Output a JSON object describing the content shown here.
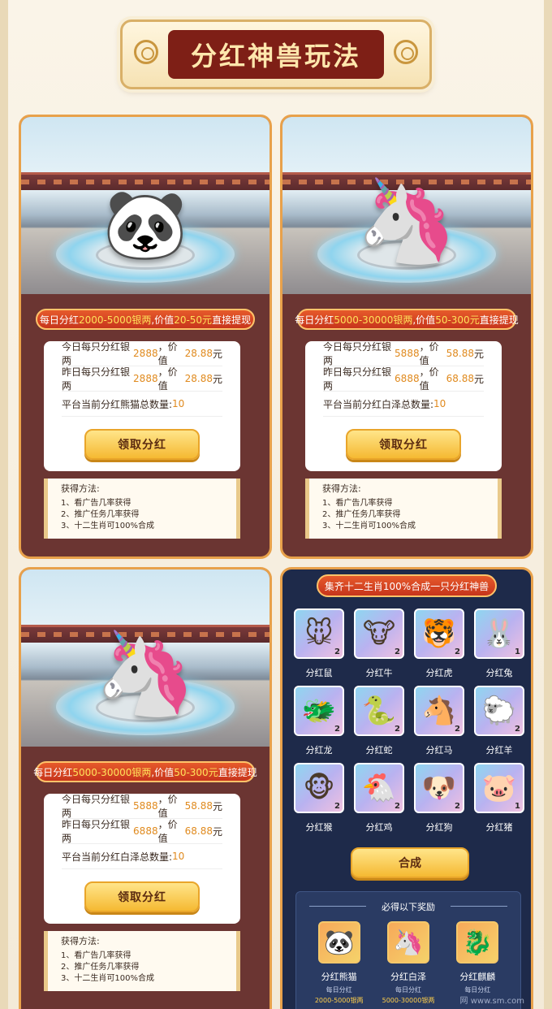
{
  "header": {
    "title": "分红神兽玩法"
  },
  "cards": [
    {
      "creature_icon": "panda",
      "tag": {
        "prefix": "每日分红",
        "silver": "2000-5000银两",
        "mid": ",价值",
        "value": "20-50元",
        "suffix": "直接提现"
      },
      "rows": [
        {
          "label": "今日每只分红银两",
          "silver": "2888",
          "mid": "，价值",
          "value": "28.88",
          "unit": "元"
        },
        {
          "label": "昨日每只分红银两",
          "silver": "2888",
          "mid": "，价值",
          "value": "28.88",
          "unit": "元"
        }
      ],
      "total_label": "平台当前分红熊猫总数量:",
      "total_value": "10",
      "button": "领取分红",
      "method_title": "获得方法:",
      "methods": [
        "1、看广告几率获得",
        "2、推广任务几率获得",
        "3、十二生肖可100%合成"
      ]
    },
    {
      "creature_icon": "baize",
      "tag": {
        "prefix": "每日分红",
        "silver": "5000-30000银两",
        "mid": ",价值",
        "value": "50-300元",
        "suffix": "直接提现"
      },
      "rows": [
        {
          "label": "今日每只分红银两",
          "silver": "5888",
          "mid": "，价值",
          "value": "58.88",
          "unit": "元"
        },
        {
          "label": "昨日每只分红银两",
          "silver": "6888",
          "mid": "，价值",
          "value": "68.88",
          "unit": "元"
        }
      ],
      "total_label": "平台当前分红白泽总数量:",
      "total_value": "10",
      "button": "领取分红",
      "method_title": "获得方法:",
      "methods": [
        "1、看广告几率获得",
        "2、推广任务几率获得",
        "3、十二生肖可100%合成"
      ]
    },
    {
      "creature_icon": "baize",
      "tag": {
        "prefix": "每日分红",
        "silver": "5000-30000银两",
        "mid": ",价值",
        "value": "50-300元",
        "suffix": "直接提现"
      },
      "rows": [
        {
          "label": "今日每只分红银两",
          "silver": "5888",
          "mid": "，价值",
          "value": "58.88",
          "unit": "元"
        },
        {
          "label": "昨日每只分红银两",
          "silver": "6888",
          "mid": "，价值",
          "value": "68.88",
          "unit": "元"
        }
      ],
      "total_label": "平台当前分红白泽总数量:",
      "total_value": "10",
      "button": "领取分红",
      "method_title": "获得方法:",
      "methods": [
        "1、看广告几率获得",
        "2、推广任务几率获得",
        "3、十二生肖可100%合成"
      ]
    }
  ],
  "zodiac": {
    "title": "集齐十二生肖100%合成一只分红神兽",
    "items": [
      {
        "name": "分红鼠",
        "icon": "🐭",
        "count": "2"
      },
      {
        "name": "分红牛",
        "icon": "🐮",
        "count": "2"
      },
      {
        "name": "分红虎",
        "icon": "🐯",
        "count": "2"
      },
      {
        "name": "分红兔",
        "icon": "🐰",
        "count": "1"
      },
      {
        "name": "分红龙",
        "icon": "🐲",
        "count": "2"
      },
      {
        "name": "分红蛇",
        "icon": "🐍",
        "count": "2"
      },
      {
        "name": "分红马",
        "icon": "🐴",
        "count": "2"
      },
      {
        "name": "分红羊",
        "icon": "🐑",
        "count": "2"
      },
      {
        "name": "分红猴",
        "icon": "🐵",
        "count": "2"
      },
      {
        "name": "分红鸡",
        "icon": "🐔",
        "count": "2"
      },
      {
        "name": "分红狗",
        "icon": "🐶",
        "count": "2"
      },
      {
        "name": "分红猪",
        "icon": "🐷",
        "count": "1"
      }
    ],
    "combine_button": "合成",
    "reward_title": "必得以下奖励",
    "rewards": [
      {
        "name": "分红熊猫",
        "sub": "每日分红",
        "range": "2000-5000银两",
        "icon": "🐼"
      },
      {
        "name": "分红白泽",
        "sub": "每日分红",
        "range": "5000-30000银两",
        "icon": "🦄"
      },
      {
        "name": "分红麒麟",
        "sub": "每日分红",
        "range": "",
        "icon": "🐉"
      }
    ],
    "watermark": "网 www.sm.com"
  }
}
